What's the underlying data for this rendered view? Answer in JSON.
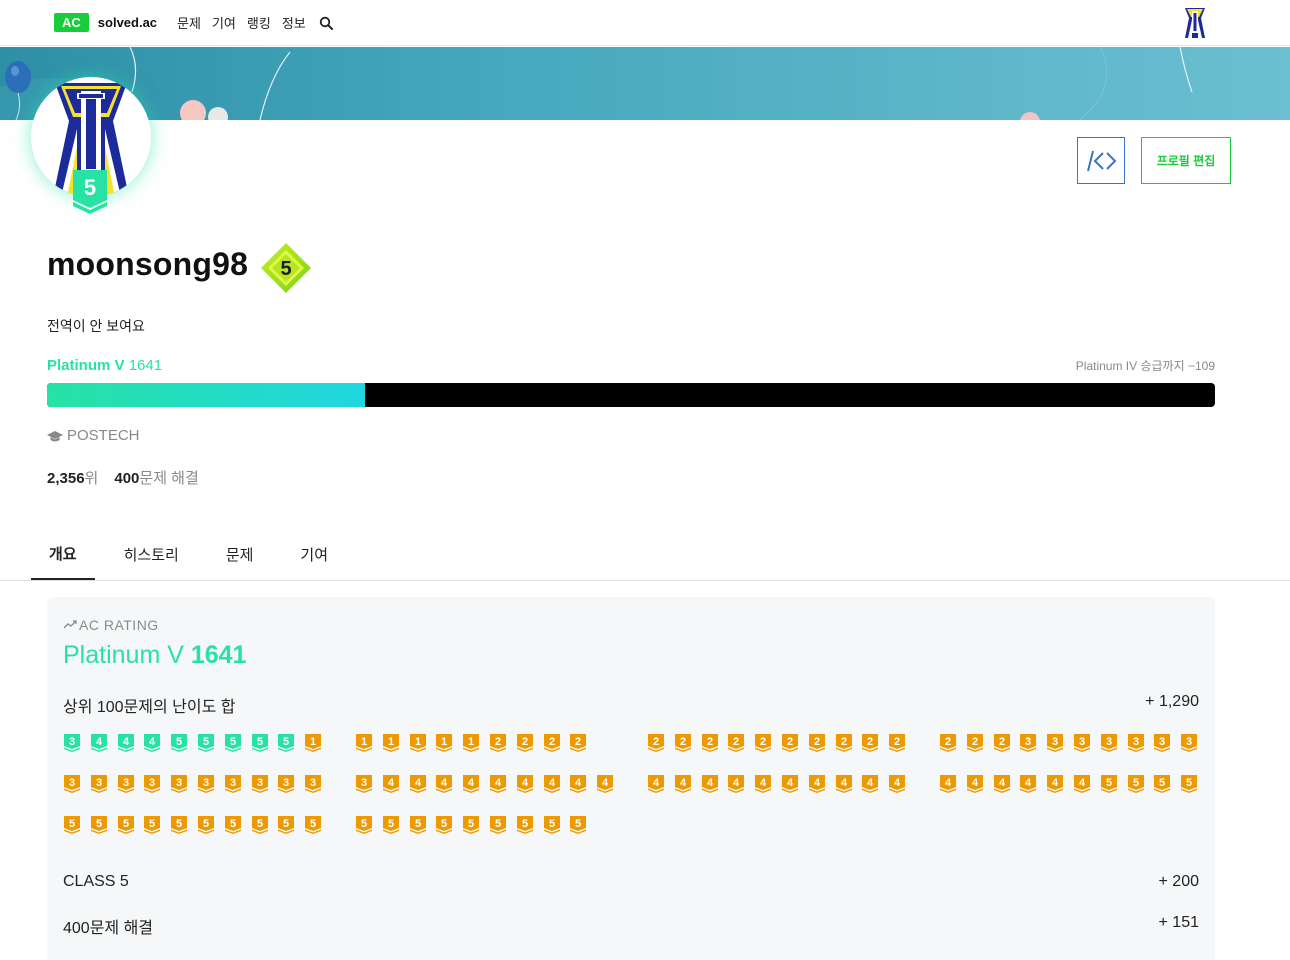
{
  "nav": {
    "logo_badge": "AC",
    "logo_text": "solved.ac",
    "items": [
      "문제",
      "기여",
      "랭킹",
      "정보"
    ],
    "search_icon": "search-icon"
  },
  "profile": {
    "username": "moonsong98",
    "tier_number": "5",
    "bio": "전역이 안 보여요",
    "rating_tier": "Platinum V",
    "rating_value": "1641",
    "next_tier_text": "Platinum IV 승급까지 −109",
    "progress_fraction": 0.272,
    "organization": "POSTECH",
    "rank": "2,356",
    "rank_suffix": "위",
    "solved_count": "400",
    "solved_suffix": "문제 해결",
    "edit_button": "프로필 편집",
    "code_button_icon": "code-icon"
  },
  "tabs": [
    "개요",
    "히스토리",
    "문제",
    "기여"
  ],
  "card": {
    "label": "AC RATING",
    "rating_tier": "Platinum V",
    "rating_value": "1641",
    "top100_label": "상위 100문제의 난이도 합",
    "top100_value": "+ 1,290",
    "class_label": "CLASS 5",
    "class_value": "+ 200",
    "solved_label": "400문제 해결",
    "solved_value": "+ 151"
  },
  "colors": {
    "accent": "#17ce3a",
    "platinum": "#27e2a4",
    "gold": "#ec9a00",
    "code_button": "#3b74c4"
  },
  "problem_badges": [
    [
      [
        [
          "p",
          3
        ],
        [
          "p",
          4
        ],
        [
          "p",
          4
        ],
        [
          "p",
          4
        ],
        [
          "p",
          5
        ],
        [
          "p",
          5
        ],
        [
          "p",
          5
        ],
        [
          "p",
          5
        ],
        [
          "p",
          5
        ],
        [
          "g",
          1
        ]
      ],
      [
        [
          "g",
          1
        ],
        [
          "g",
          1
        ],
        [
          "g",
          1
        ],
        [
          "g",
          1
        ],
        [
          "g",
          1
        ],
        [
          "g",
          2
        ],
        [
          "g",
          2
        ],
        [
          "g",
          2
        ],
        [
          "g",
          2
        ]
      ],
      [
        [
          "g",
          2
        ],
        [
          "g",
          2
        ],
        [
          "g",
          2
        ],
        [
          "g",
          2
        ],
        [
          "g",
          2
        ],
        [
          "g",
          2
        ],
        [
          "g",
          2
        ],
        [
          "g",
          2
        ],
        [
          "g",
          2
        ],
        [
          "g",
          2
        ]
      ],
      [
        [
          "g",
          2
        ],
        [
          "g",
          2
        ],
        [
          "g",
          2
        ],
        [
          "g",
          3
        ],
        [
          "g",
          3
        ],
        [
          "g",
          3
        ],
        [
          "g",
          3
        ],
        [
          "g",
          3
        ],
        [
          "g",
          3
        ],
        [
          "g",
          3
        ]
      ]
    ],
    [
      [
        [
          "g",
          3
        ],
        [
          "g",
          3
        ],
        [
          "g",
          3
        ],
        [
          "g",
          3
        ],
        [
          "g",
          3
        ],
        [
          "g",
          3
        ],
        [
          "g",
          3
        ],
        [
          "g",
          3
        ],
        [
          "g",
          3
        ],
        [
          "g",
          3
        ]
      ],
      [
        [
          "g",
          3
        ],
        [
          "g",
          4
        ],
        [
          "g",
          4
        ],
        [
          "g",
          4
        ],
        [
          "g",
          4
        ],
        [
          "g",
          4
        ],
        [
          "g",
          4
        ],
        [
          "g",
          4
        ],
        [
          "g",
          4
        ],
        [
          "g",
          4
        ]
      ],
      [
        [
          "g",
          4
        ],
        [
          "g",
          4
        ],
        [
          "g",
          4
        ],
        [
          "g",
          4
        ],
        [
          "g",
          4
        ],
        [
          "g",
          4
        ],
        [
          "g",
          4
        ],
        [
          "g",
          4
        ],
        [
          "g",
          4
        ],
        [
          "g",
          4
        ]
      ],
      [
        [
          "g",
          4
        ],
        [
          "g",
          4
        ],
        [
          "g",
          4
        ],
        [
          "g",
          4
        ],
        [
          "g",
          4
        ],
        [
          "g",
          4
        ],
        [
          "g",
          5
        ],
        [
          "g",
          5
        ],
        [
          "g",
          5
        ],
        [
          "g",
          5
        ]
      ]
    ],
    [
      [
        [
          "g",
          5
        ],
        [
          "g",
          5
        ],
        [
          "g",
          5
        ],
        [
          "g",
          5
        ],
        [
          "g",
          5
        ],
        [
          "g",
          5
        ],
        [
          "g",
          5
        ],
        [
          "g",
          5
        ],
        [
          "g",
          5
        ],
        [
          "g",
          5
        ]
      ],
      [
        [
          "g",
          5
        ],
        [
          "g",
          5
        ],
        [
          "g",
          5
        ],
        [
          "g",
          5
        ],
        [
          "g",
          5
        ],
        [
          "g",
          5
        ],
        [
          "g",
          5
        ],
        [
          "g",
          5
        ],
        [
          "g",
          5
        ]
      ]
    ]
  ]
}
